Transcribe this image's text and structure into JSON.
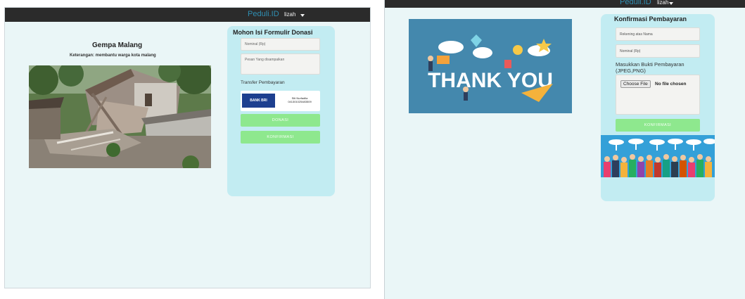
{
  "left": {
    "navbar": {
      "brand": "Peduli.ID",
      "user": "lizah"
    },
    "campaign": {
      "title": "Gempa Malang",
      "description": "Keterangan: membantu warga kota malang"
    },
    "form": {
      "title": "Mohon Isi Formulir Donasi",
      "nominal_placeholder": "Nominal (Rp)",
      "message_placeholder": "Pesan Yang disampaikan",
      "transfer_label": "Transfer Pembayaran",
      "bank": {
        "logo": "BANK BRI",
        "account_name": "Siti Nurfadila",
        "account_number": "041301025483509"
      },
      "donate_button": "DONASI",
      "confirm_button": "KONFIRMASI"
    }
  },
  "right": {
    "navbar": {
      "brand": "Peduli.ID",
      "user": "lizah"
    },
    "banner_text": "THANK YOU",
    "confirm_form": {
      "title": "Konfirmasi Pembayaran",
      "account_placeholder": "Rekening atas Nama",
      "nominal_placeholder": "Nominal (Rp)",
      "upload_label": "Masukkan Bukti Pembayaran (JPEG,PNG)",
      "choose_file": "Choose File",
      "file_status": "No file chosen",
      "confirm_button": "KONFIRMASI"
    }
  },
  "colors": {
    "navbar": "#2b2b2b",
    "brand": "#2f8fb3",
    "page_bg": "#eaf6f7",
    "panel_bg": "#c2ecf2",
    "button_green": "#8ee88e",
    "banner_bg": "#4488ad"
  }
}
